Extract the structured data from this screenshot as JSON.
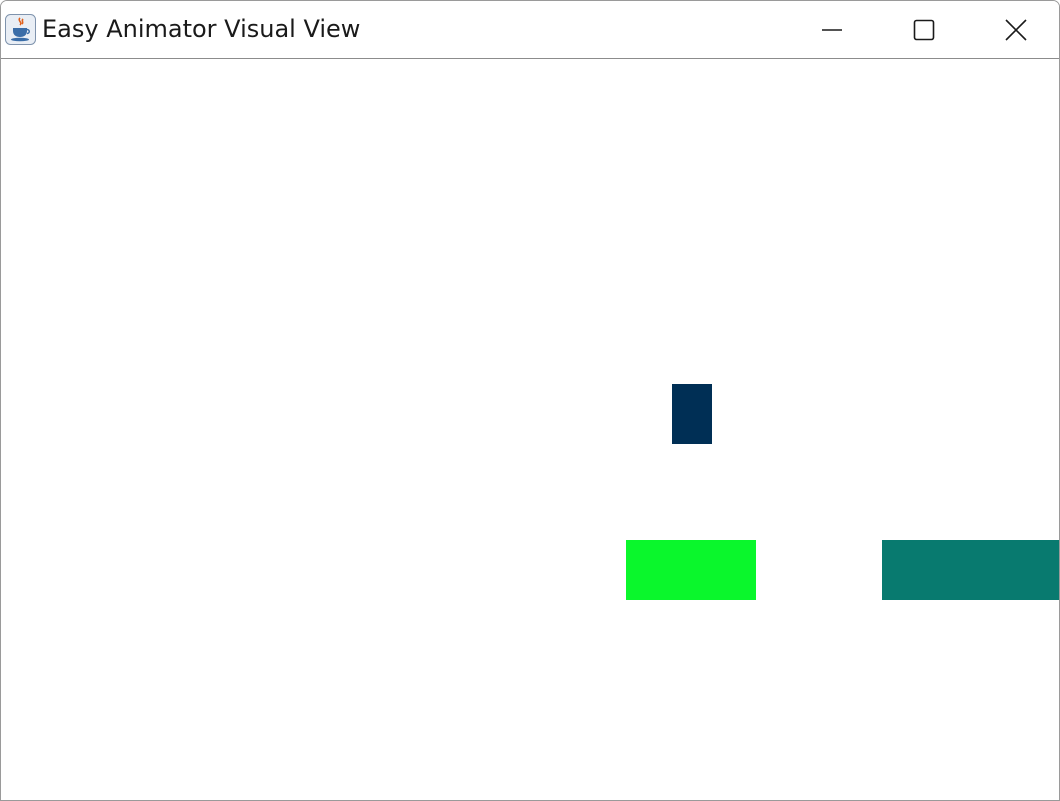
{
  "window": {
    "title": "Easy Animator Visual View",
    "app_icon": "java-coffee-cup-icon",
    "controls": {
      "minimize_icon": "minimize-icon",
      "maximize_icon": "maximize-icon",
      "close_icon": "close-icon"
    }
  },
  "canvas": {
    "background": "#ffffff",
    "shapes": [
      {
        "kind": "rectangle",
        "color": "#002F55"
      },
      {
        "kind": "rectangle",
        "color": "#0AF72C"
      },
      {
        "kind": "rectangle",
        "color": "#087A6F"
      }
    ]
  }
}
